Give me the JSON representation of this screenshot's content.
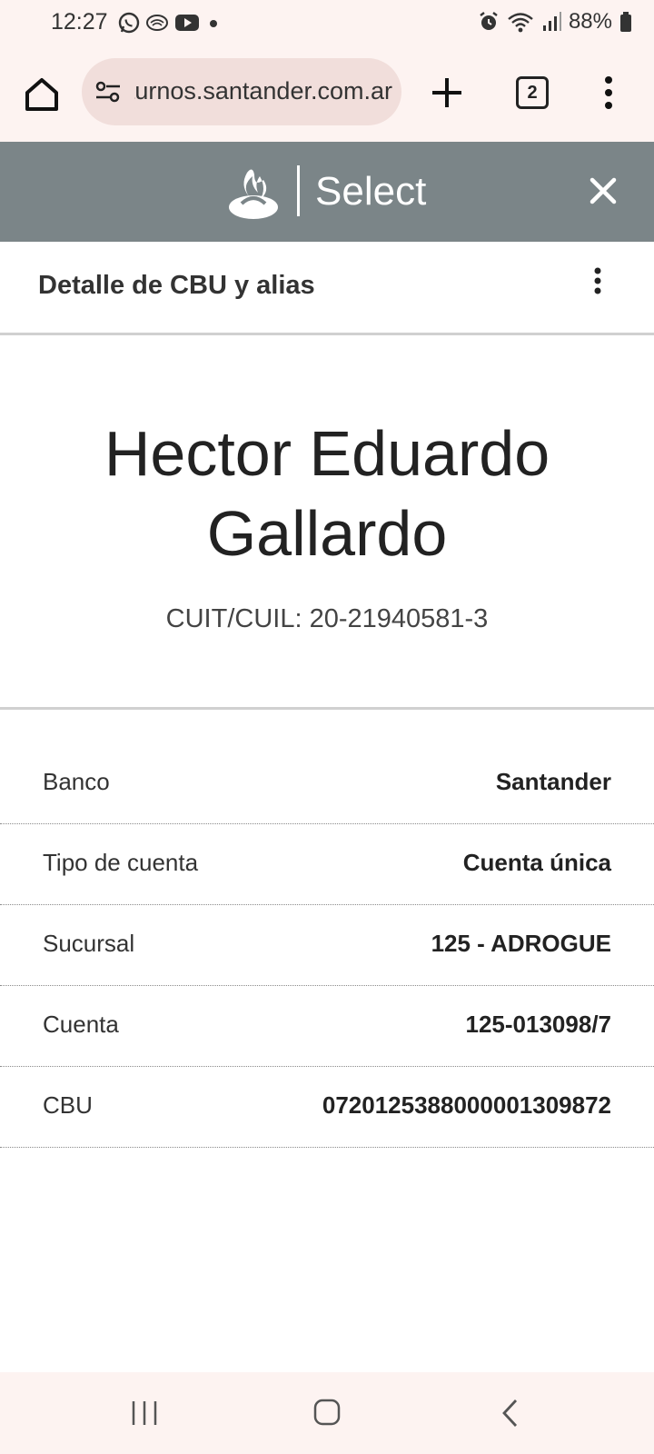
{
  "status_bar": {
    "time": "12:27",
    "battery": "88%",
    "left_icons": [
      "whatsapp-icon",
      "cast-icon",
      "youtube-icon",
      "dot-icon"
    ],
    "right_icons": [
      "alarm-icon",
      "wifi-icon",
      "signal-icon",
      "battery-icon"
    ]
  },
  "browser": {
    "url": "turnos.santander.com.ar",
    "tab_count": "2"
  },
  "app_header": {
    "brand": "Select",
    "colors": {
      "header_bg": "#7b8588",
      "logo": "#ffffff"
    }
  },
  "subheader": {
    "title": "Detalle de CBU y alias"
  },
  "profile": {
    "name": "Hector Eduardo Gallardo",
    "cuit": "CUIT/CUIL: 20-21940581-3"
  },
  "details": [
    {
      "label": "Banco",
      "value": "Santander"
    },
    {
      "label": "Tipo de cuenta",
      "value": "Cuenta única"
    },
    {
      "label": "Sucursal",
      "value": "125 - ADROGUE"
    },
    {
      "label": "Cuenta",
      "value": "125-013098/7"
    },
    {
      "label": "CBU",
      "value": "0720125388000001309872"
    }
  ]
}
